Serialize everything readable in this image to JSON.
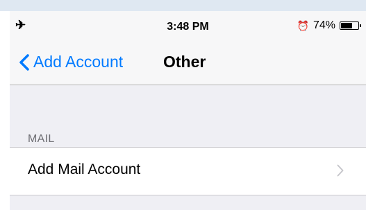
{
  "status_bar": {
    "airplane_icon": "airplane-icon",
    "time": "3:48 PM",
    "alarm_icon": "alarm-icon",
    "battery_percent": "74%",
    "battery_level": 0.74
  },
  "nav": {
    "back_label": "Add Account",
    "title": "Other"
  },
  "sections": {
    "mail": {
      "header": "MAIL",
      "items": [
        {
          "label": "Add Mail Account"
        }
      ]
    }
  },
  "colors": {
    "accent": "#007aff",
    "background": "#efeff4"
  }
}
